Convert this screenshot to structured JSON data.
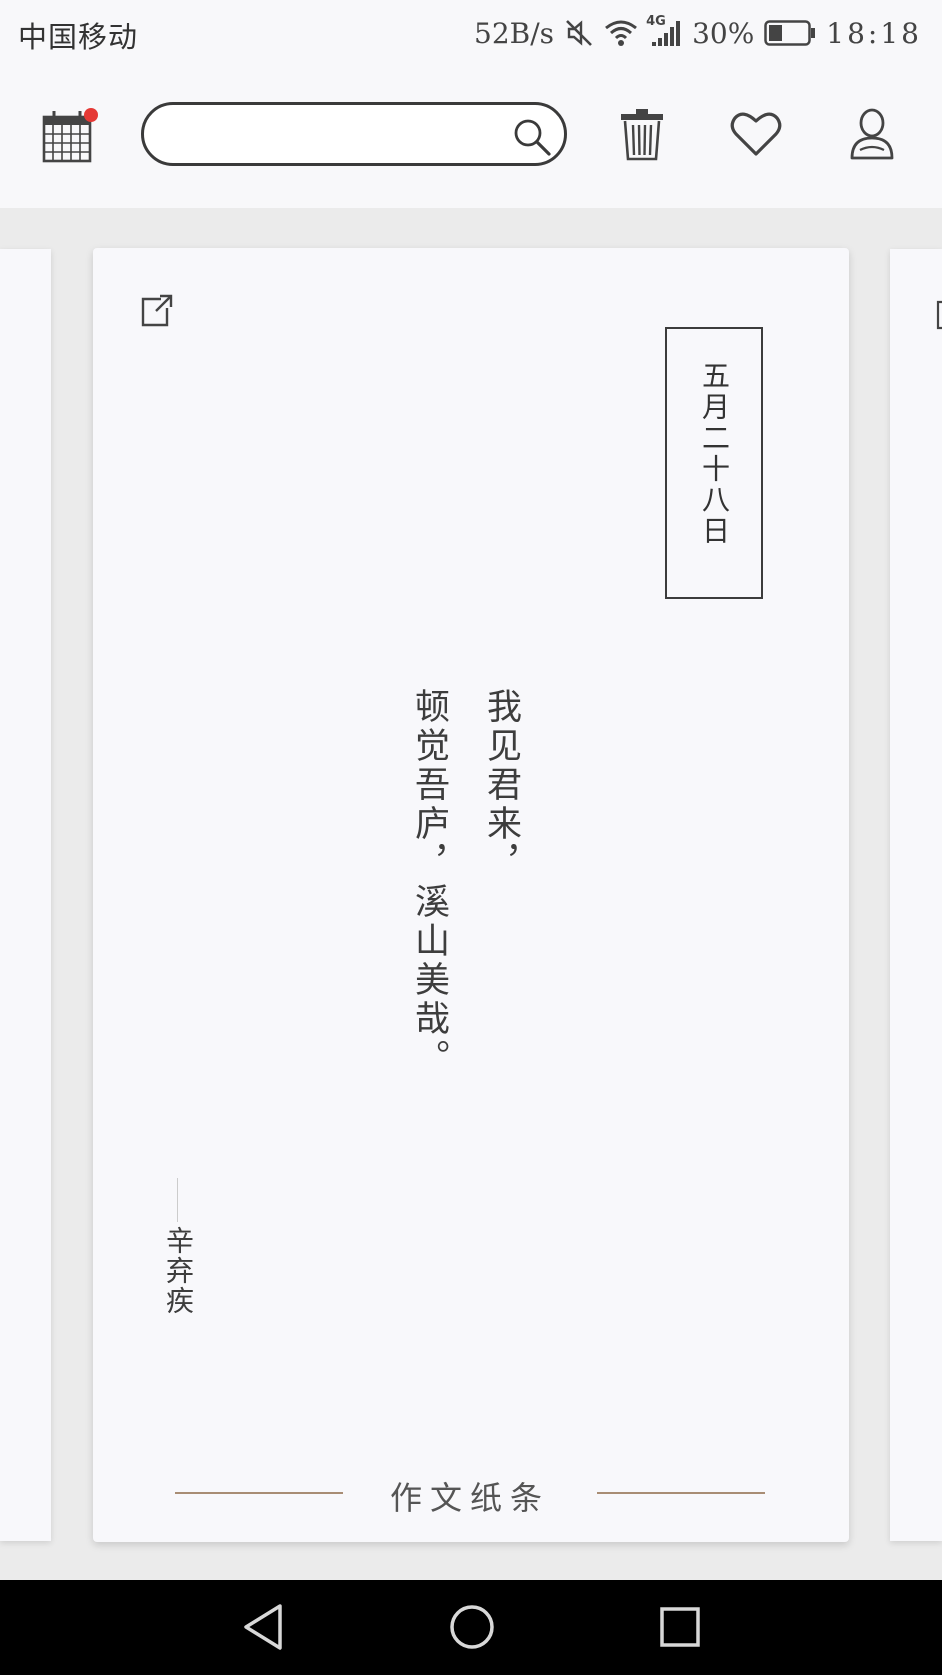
{
  "status_bar": {
    "carrier": "中国移动",
    "net_speed": "52B/s",
    "network_type": "4G",
    "battery_percent": "30%",
    "time": "18:18",
    "icons": [
      "mute-icon",
      "wifi-icon",
      "signal-icon",
      "battery-icon"
    ]
  },
  "toolbar": {
    "search_placeholder": "",
    "icons": [
      "calendar-icon",
      "search-icon",
      "trash-icon",
      "heart-icon",
      "profile-icon"
    ],
    "notification_dot_color": "#e53935"
  },
  "card": {
    "date": "五月二十八日",
    "poem_lines": [
      "我见君来，",
      "顿觉吾庐，溪山美哉。"
    ],
    "author": "辛弃疾",
    "brand": "作文纸条",
    "accent_color": "#a88d74",
    "icons": [
      "share-icon"
    ]
  },
  "nav_bar": {
    "icons": [
      "back-icon",
      "home-icon",
      "recents-icon"
    ]
  }
}
